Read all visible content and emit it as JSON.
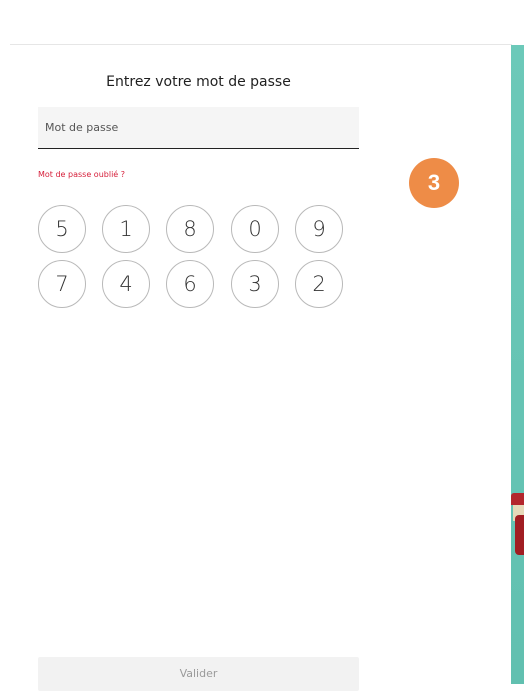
{
  "login": {
    "title": "Entrez votre mot de passe",
    "password_placeholder": "Mot de passe",
    "forgot_link": "Mot de passe oublié ?",
    "submit_label": "Valider"
  },
  "keypad": {
    "row1": [
      "5",
      "1",
      "8",
      "0",
      "9"
    ],
    "row2": [
      "7",
      "4",
      "6",
      "3",
      "2"
    ]
  },
  "step_badge": {
    "label": "3",
    "color": "#ee8c47"
  },
  "colors": {
    "accent_link": "#d6203b",
    "side_panel": "#6cc9b9"
  }
}
